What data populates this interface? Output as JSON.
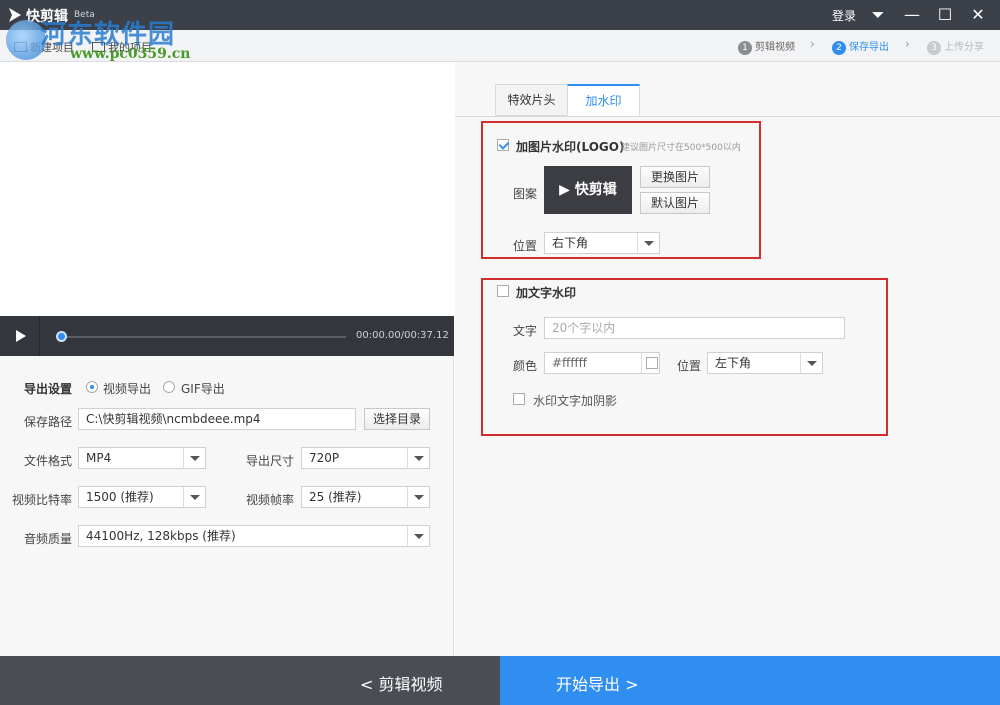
{
  "app": {
    "name": "快剪辑",
    "badge": "Beta",
    "login": "登录"
  },
  "overlay": {
    "site_name": "河东软件园",
    "site_url": "www.pc0359.cn"
  },
  "window": {
    "min": "—",
    "max": "☐",
    "close": "✕",
    "menu": "⏷"
  },
  "toolbar": {
    "new_project": "新建项目",
    "my_projects": "我的项目"
  },
  "steps": [
    {
      "num": "1",
      "label": "剪辑视频"
    },
    {
      "num": "2",
      "label": "保存导出"
    },
    {
      "num": "3",
      "label": "上传分享"
    }
  ],
  "player": {
    "time": "00:00.00/00:37.12",
    "progress": 0.0
  },
  "export": {
    "title": "导出设置",
    "option_video": "视频导出",
    "option_gif": "GIF导出",
    "path_label": "保存路径",
    "path_value": "C:\\快剪辑视频\\ncmbdeee.mp4",
    "browse": "选择目录",
    "format_label": "文件格式",
    "format_value": "MP4",
    "size_label": "导出尺寸",
    "size_value": "720P",
    "bitrate_label": "视频比特率",
    "bitrate_value": "1500 (推荐)",
    "fps_label": "视频帧率",
    "fps_value": "25 (推荐)",
    "audio_label": "音频质量",
    "audio_value": "44100Hz, 128kbps (推荐)"
  },
  "bottom": {
    "back": "<  剪辑视频",
    "start": "开始导出  >"
  },
  "tabs": [
    {
      "label": "特效片头"
    },
    {
      "label": "加水印"
    }
  ],
  "image_wm": {
    "title": "加图片水印(LOGO)",
    "hint": "建议图片尺寸在500*500以内",
    "pattern_label": "图案",
    "logo_text": "▶ 快剪辑",
    "replace": "更换图片",
    "default": "默认图片",
    "position_label": "位置",
    "position_value": "右下角"
  },
  "text_wm": {
    "title": "加文字水印",
    "text_label": "文字",
    "text_placeholder": "20个字以内",
    "color_label": "颜色",
    "color_value": "#ffffff",
    "position_label": "位置",
    "position_value": "左下角",
    "shadow_label": "水印文字加阴影"
  },
  "colors": {
    "accent": "#2f8ef0",
    "highlight": "#d22d2d",
    "titlebar": "#3c4049"
  }
}
